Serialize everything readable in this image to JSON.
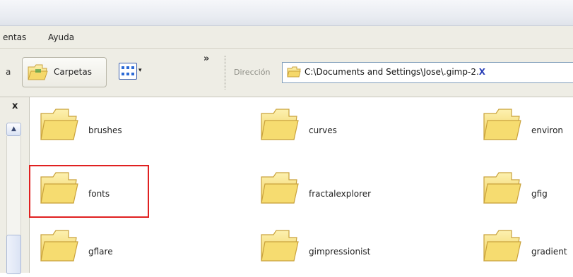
{
  "menubar": {
    "items": [
      "entas",
      "Ayuda"
    ]
  },
  "toolbar": {
    "fragment": "a",
    "folders_label": "Carpetas",
    "views_caret": "▾",
    "more": "»",
    "address_label": "Dirección",
    "address_value": "C:\\Documents and Settings\\Jose\\.gimp-2.",
    "address_suffix": "X"
  },
  "left_pane": {
    "close": "x",
    "scroll_up": "▲"
  },
  "folders": [
    {
      "name": "brushes"
    },
    {
      "name": "curves"
    },
    {
      "name": "environ"
    },
    {
      "name": "fonts"
    },
    {
      "name": "fractalexplorer"
    },
    {
      "name": "gfig"
    },
    {
      "name": "gflare"
    },
    {
      "name": "gimpressionist"
    },
    {
      "name": "gradient"
    }
  ],
  "highlighted_folder": "fonts",
  "colors": {
    "folder_fill": "#f7df7a",
    "folder_edge": "#c9a23c",
    "highlight": "#e02020",
    "address_accent": "#2a3fb7"
  }
}
